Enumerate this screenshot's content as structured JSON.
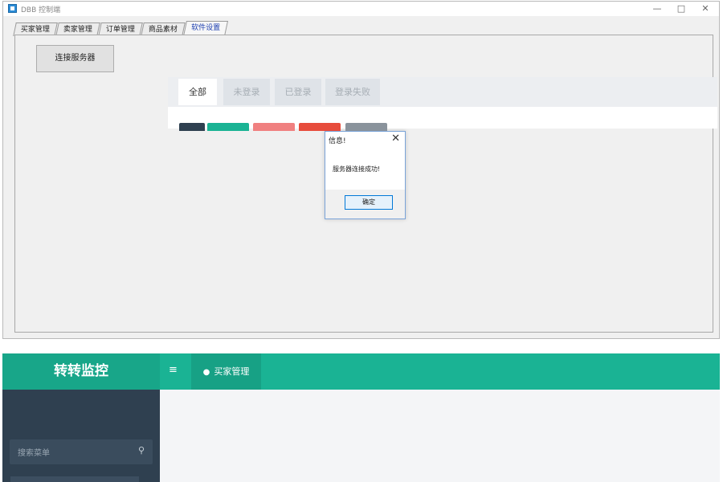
{
  "window": {
    "title": "DBB 控制端",
    "controls": {
      "minimize": "—",
      "maximize": "□",
      "close": "✕"
    },
    "tabs": [
      "买家管理",
      "卖家管理",
      "订单管理",
      "商品素材",
      "软件设置"
    ],
    "active_tab": "软件设置",
    "connect_button": "连接服务器"
  },
  "dialog": {
    "title": "信息!",
    "close": "✕",
    "message": "服务器连接成功!",
    "ok_button": "确定"
  },
  "web": {
    "logo": "转转监控",
    "hamburger": "≡",
    "nav_tab": "买家管理",
    "search_placeholder": "搜索菜单",
    "search_icon": "⚲",
    "filter_tabs": [
      "全部",
      "未登录",
      "已登录",
      "登录失败"
    ]
  },
  "colors": {
    "header": "#1ab394",
    "sidebar": "#2f4050",
    "dialog_border": "#7aa3d8",
    "active_tab_text": "#1d3fb0",
    "buttons": [
      "#2f4050",
      "#1ab394",
      "#f08080",
      "#e74c3c",
      "#8a939c"
    ]
  }
}
